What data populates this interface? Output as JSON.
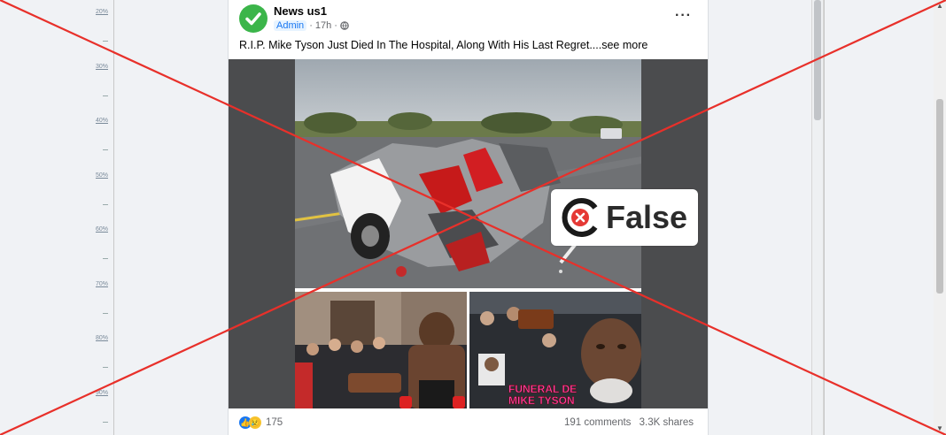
{
  "ruler": {
    "labels": [
      "20%",
      "30%",
      "40%",
      "50%",
      "60%",
      "70%",
      "80%",
      "90%"
    ]
  },
  "post": {
    "author": "News us1",
    "role": "Admin",
    "time": "17h",
    "text": "R.I.P. Mike Tyson Just Died In The Hospital, Along With His Last Regret....see more",
    "more_icon": "ellipsis-icon",
    "image_caption": "FUNERAL DE MIKE TYSON",
    "reactions_count": "175",
    "comments": "191 comments",
    "shares": "3.3K shares"
  },
  "fact_check": {
    "label": "False",
    "accent": "#e53935"
  },
  "colors": {
    "cross_lines": "#e8302a",
    "verified_avatar": "#3bb54a",
    "like_blue": "#1877f2"
  }
}
